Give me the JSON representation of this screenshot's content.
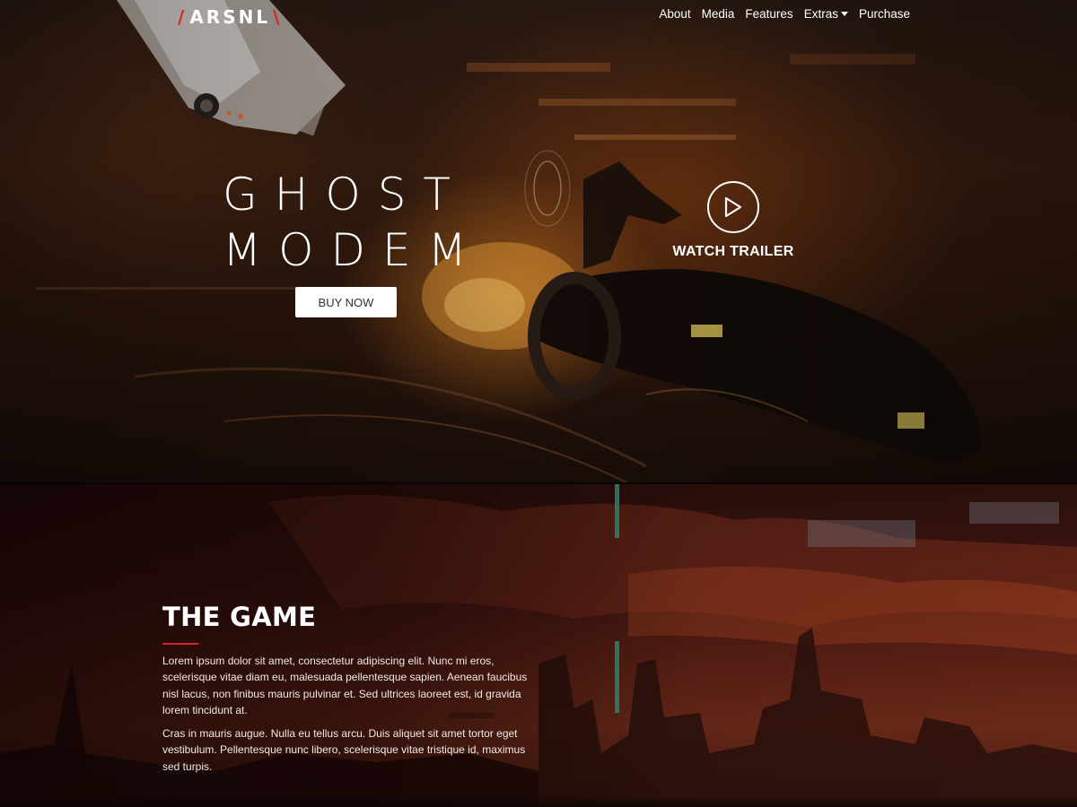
{
  "nav": {
    "brand": {
      "slash_left": "/",
      "name": "ARSNL",
      "slash_right": "\\"
    },
    "items": [
      {
        "label": "About"
      },
      {
        "label": "Media"
      },
      {
        "label": "Features"
      },
      {
        "label": "Extras",
        "dropdown": true
      },
      {
        "label": "Purchase"
      }
    ]
  },
  "hero": {
    "title_line_1": "GHOST",
    "title_line_2": "MODEM",
    "buy_label": "BUY NOW",
    "trailer_label": "WATCH TRAILER"
  },
  "game_section": {
    "title": "THE GAME",
    "paragraphs": [
      "Lorem ipsum dolor sit amet, consectetur adipiscing elit. Nunc mi eros, scelerisque vitae diam eu, malesuada pellentesque sapien. Aenean faucibus nisl lacus, non finibus mauris pulvinar et. Sed ultrices laoreet est, id gravida lorem tincidunt at.",
      "Cras in mauris augue. Nulla eu tellus arcu. Duis aliquet sit amet tortor eget vestibulum. Pellentesque nunc libero, scelerisque vitae tristique id, maximus sed turpis."
    ]
  },
  "colors": {
    "accent": "#e01f26",
    "hero_dark": "#2a1a12",
    "section_red": "#5a2014"
  },
  "icons": {
    "play": "play-icon",
    "dropdown": "caret-down-icon"
  }
}
